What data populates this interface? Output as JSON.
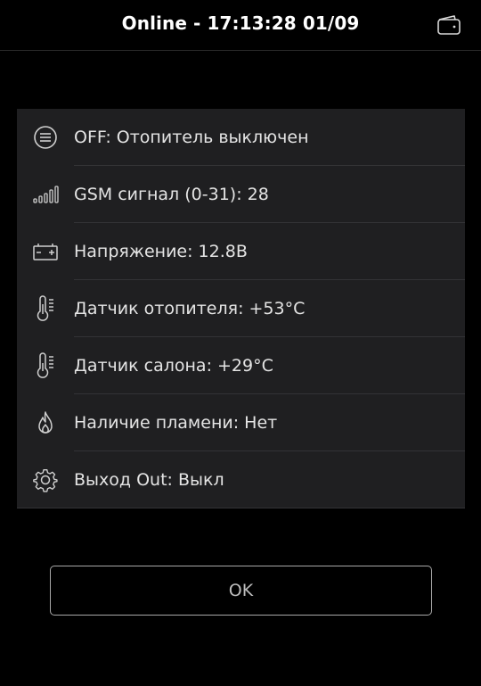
{
  "header": {
    "title": "Online - 17:13:28 01/09",
    "icon": "wallet-icon"
  },
  "status_rows": [
    {
      "icon": "menu-circle-icon",
      "label": "OFF: Отопитель выключен"
    },
    {
      "icon": "signal-bars-icon",
      "label": "GSM сигнал (0-31): 28"
    },
    {
      "icon": "battery-icon",
      "label": "Напряжение: 12.8В"
    },
    {
      "icon": "thermometer-icon",
      "label": "Датчик отопителя: +53°C"
    },
    {
      "icon": "thermometer-icon",
      "label": "Датчик салона: +29°C"
    },
    {
      "icon": "flame-icon",
      "label": "Наличие пламени: Нет"
    },
    {
      "icon": "gear-icon",
      "label": "Выход Out: Выкл"
    }
  ],
  "ok_button": {
    "label": "OK"
  },
  "colors": {
    "background": "#000000",
    "card": "#1f1f21",
    "text": "#e4e4e4",
    "icon": "#cfcfcf",
    "separator": "#333336",
    "button_border": "#a8a8a8"
  }
}
